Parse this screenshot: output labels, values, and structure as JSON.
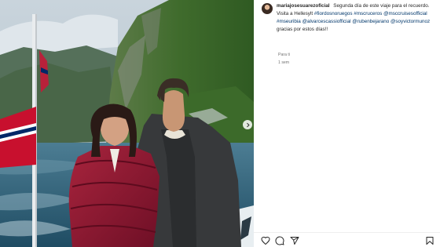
{
  "post": {
    "username": "mariajosesuarezoficial",
    "caption_parts": [
      {
        "type": "text",
        "text": " Segunda día de este viaje para el recuerdo. Visita a Hellesylt "
      },
      {
        "type": "tag",
        "text": "#fiordosnoruegos"
      },
      {
        "type": "text",
        "text": " "
      },
      {
        "type": "tag",
        "text": "#mscruceros"
      },
      {
        "type": "text",
        "text": " "
      },
      {
        "type": "tag",
        "text": "@msccruisesofficial"
      },
      {
        "type": "text",
        "text": " "
      },
      {
        "type": "tag",
        "text": "#mseuribia"
      },
      {
        "type": "text",
        "text": " "
      },
      {
        "type": "tag",
        "text": "@alvarcescassiofficial"
      },
      {
        "type": "text",
        "text": " "
      },
      {
        "type": "tag",
        "text": "@rubenbejarano"
      },
      {
        "type": "text",
        "text": " "
      },
      {
        "type": "tag",
        "text": "@soyvictormunoz"
      },
      {
        "type": "text",
        "text": " gracias por estos días!!"
      }
    ],
    "translate_label": "Para ti",
    "time_ago": "1 sem"
  },
  "icons": {
    "like": "heart-icon",
    "comment": "comment-icon",
    "share": "paper-plane-icon",
    "save": "bookmark-icon",
    "next": "chevron-right-icon"
  },
  "colors": {
    "link": "#00376b",
    "secondary_text": "#737373",
    "flag_red": "#c8102e",
    "flag_blue": "#002868"
  }
}
